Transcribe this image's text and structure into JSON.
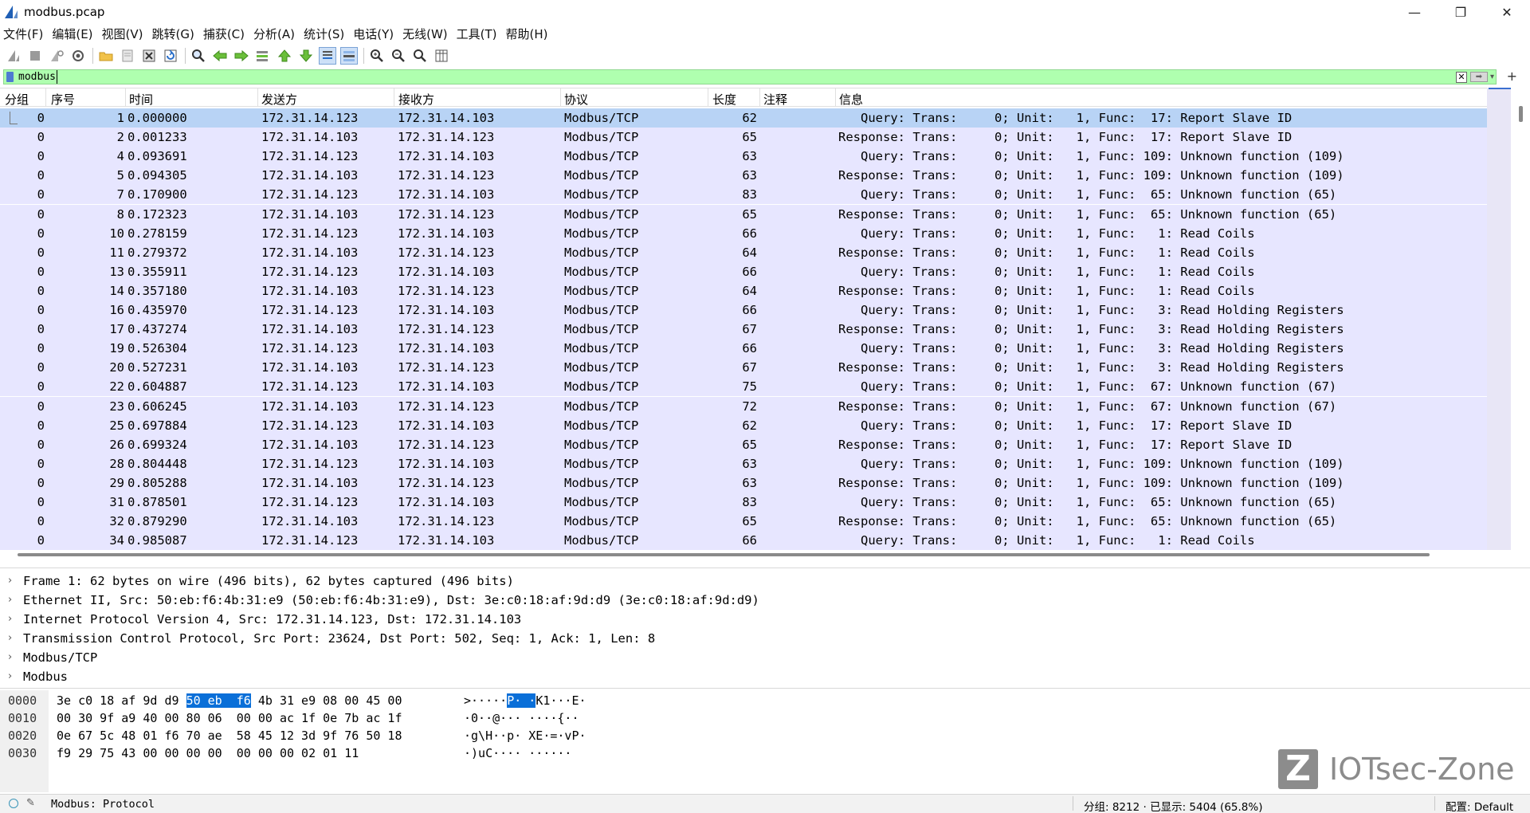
{
  "window": {
    "title": "modbus.pcap",
    "minimize_glyph": "—",
    "maximize_glyph": "❐",
    "close_glyph": "✕"
  },
  "menu": [
    "文件(F)",
    "编辑(E)",
    "视图(V)",
    "跳转(G)",
    "捕获(C)",
    "分析(A)",
    "统计(S)",
    "电话(Y)",
    "无线(W)",
    "工具(T)",
    "帮助(H)"
  ],
  "toolbar_icons": [
    "shark-fin-start-icon",
    "stop-square-icon",
    "restart-fin-icon",
    "capture-options-gear-icon",
    "open-folder-icon",
    "save-file-icon",
    "close-file-icon",
    "reload-icon",
    "find-magnifier-icon",
    "go-back-arrow-icon",
    "go-forward-arrow-icon",
    "go-to-packet-icon",
    "first-packet-icon",
    "last-packet-icon",
    "autoscroll-icon",
    "colorize-icon",
    "zoom-in-icon",
    "zoom-out-icon",
    "normal-size-icon",
    "resize-columns-icon"
  ],
  "filter": {
    "value": "modbus",
    "clear_glyph": "✕",
    "apply_glyph": "➡",
    "dropdown_glyph": "▾",
    "add_glyph": "+"
  },
  "columns": {
    "group": "分组",
    "no": "序号",
    "time": "时间",
    "source": "发送方",
    "destination": "接收方",
    "protocol": "协议",
    "length": "长度",
    "comment": "注释",
    "info": "信息"
  },
  "packets": [
    {
      "group": "0",
      "no": "1",
      "time": "0.000000",
      "src": "172.31.14.123",
      "dst": "172.31.14.103",
      "proto": "Modbus/TCP",
      "len": "62",
      "info": "   Query: Trans:     0; Unit:   1, Func:  17: Report Slave ID"
    },
    {
      "group": "0",
      "no": "2",
      "time": "0.001233",
      "src": "172.31.14.103",
      "dst": "172.31.14.123",
      "proto": "Modbus/TCP",
      "len": "65",
      "info": "Response: Trans:     0; Unit:   1, Func:  17: Report Slave ID"
    },
    {
      "group": "0",
      "no": "4",
      "time": "0.093691",
      "src": "172.31.14.123",
      "dst": "172.31.14.103",
      "proto": "Modbus/TCP",
      "len": "63",
      "info": "   Query: Trans:     0; Unit:   1, Func: 109: Unknown function (109)"
    },
    {
      "group": "0",
      "no": "5",
      "time": "0.094305",
      "src": "172.31.14.103",
      "dst": "172.31.14.123",
      "proto": "Modbus/TCP",
      "len": "63",
      "info": "Response: Trans:     0; Unit:   1, Func: 109: Unknown function (109)"
    },
    {
      "group": "0",
      "no": "7",
      "time": "0.170900",
      "src": "172.31.14.123",
      "dst": "172.31.14.103",
      "proto": "Modbus/TCP",
      "len": "83",
      "info": "   Query: Trans:     0; Unit:   1, Func:  65: Unknown function (65)"
    },
    {
      "group": "0",
      "no": "8",
      "time": "0.172323",
      "src": "172.31.14.103",
      "dst": "172.31.14.123",
      "proto": "Modbus/TCP",
      "len": "65",
      "info": "Response: Trans:     0; Unit:   1, Func:  65: Unknown function (65)"
    },
    {
      "group": "0",
      "no": "10",
      "time": "0.278159",
      "src": "172.31.14.123",
      "dst": "172.31.14.103",
      "proto": "Modbus/TCP",
      "len": "66",
      "info": "   Query: Trans:     0; Unit:   1, Func:   1: Read Coils"
    },
    {
      "group": "0",
      "no": "11",
      "time": "0.279372",
      "src": "172.31.14.103",
      "dst": "172.31.14.123",
      "proto": "Modbus/TCP",
      "len": "64",
      "info": "Response: Trans:     0; Unit:   1, Func:   1: Read Coils"
    },
    {
      "group": "0",
      "no": "13",
      "time": "0.355911",
      "src": "172.31.14.123",
      "dst": "172.31.14.103",
      "proto": "Modbus/TCP",
      "len": "66",
      "info": "   Query: Trans:     0; Unit:   1, Func:   1: Read Coils"
    },
    {
      "group": "0",
      "no": "14",
      "time": "0.357180",
      "src": "172.31.14.103",
      "dst": "172.31.14.123",
      "proto": "Modbus/TCP",
      "len": "64",
      "info": "Response: Trans:     0; Unit:   1, Func:   1: Read Coils"
    },
    {
      "group": "0",
      "no": "16",
      "time": "0.435970",
      "src": "172.31.14.123",
      "dst": "172.31.14.103",
      "proto": "Modbus/TCP",
      "len": "66",
      "info": "   Query: Trans:     0; Unit:   1, Func:   3: Read Holding Registers"
    },
    {
      "group": "0",
      "no": "17",
      "time": "0.437274",
      "src": "172.31.14.103",
      "dst": "172.31.14.123",
      "proto": "Modbus/TCP",
      "len": "67",
      "info": "Response: Trans:     0; Unit:   1, Func:   3: Read Holding Registers"
    },
    {
      "group": "0",
      "no": "19",
      "time": "0.526304",
      "src": "172.31.14.123",
      "dst": "172.31.14.103",
      "proto": "Modbus/TCP",
      "len": "66",
      "info": "   Query: Trans:     0; Unit:   1, Func:   3: Read Holding Registers"
    },
    {
      "group": "0",
      "no": "20",
      "time": "0.527231",
      "src": "172.31.14.103",
      "dst": "172.31.14.123",
      "proto": "Modbus/TCP",
      "len": "67",
      "info": "Response: Trans:     0; Unit:   1, Func:   3: Read Holding Registers"
    },
    {
      "group": "0",
      "no": "22",
      "time": "0.604887",
      "src": "172.31.14.123",
      "dst": "172.31.14.103",
      "proto": "Modbus/TCP",
      "len": "75",
      "info": "   Query: Trans:     0; Unit:   1, Func:  67: Unknown function (67)"
    },
    {
      "group": "0",
      "no": "23",
      "time": "0.606245",
      "src": "172.31.14.103",
      "dst": "172.31.14.123",
      "proto": "Modbus/TCP",
      "len": "72",
      "info": "Response: Trans:     0; Unit:   1, Func:  67: Unknown function (67)"
    },
    {
      "group": "0",
      "no": "25",
      "time": "0.697884",
      "src": "172.31.14.123",
      "dst": "172.31.14.103",
      "proto": "Modbus/TCP",
      "len": "62",
      "info": "   Query: Trans:     0; Unit:   1, Func:  17: Report Slave ID"
    },
    {
      "group": "0",
      "no": "26",
      "time": "0.699324",
      "src": "172.31.14.103",
      "dst": "172.31.14.123",
      "proto": "Modbus/TCP",
      "len": "65",
      "info": "Response: Trans:     0; Unit:   1, Func:  17: Report Slave ID"
    },
    {
      "group": "0",
      "no": "28",
      "time": "0.804448",
      "src": "172.31.14.123",
      "dst": "172.31.14.103",
      "proto": "Modbus/TCP",
      "len": "63",
      "info": "   Query: Trans:     0; Unit:   1, Func: 109: Unknown function (109)"
    },
    {
      "group": "0",
      "no": "29",
      "time": "0.805288",
      "src": "172.31.14.103",
      "dst": "172.31.14.123",
      "proto": "Modbus/TCP",
      "len": "63",
      "info": "Response: Trans:     0; Unit:   1, Func: 109: Unknown function (109)"
    },
    {
      "group": "0",
      "no": "31",
      "time": "0.878501",
      "src": "172.31.14.123",
      "dst": "172.31.14.103",
      "proto": "Modbus/TCP",
      "len": "83",
      "info": "   Query: Trans:     0; Unit:   1, Func:  65: Unknown function (65)"
    },
    {
      "group": "0",
      "no": "32",
      "time": "0.879290",
      "src": "172.31.14.103",
      "dst": "172.31.14.123",
      "proto": "Modbus/TCP",
      "len": "65",
      "info": "Response: Trans:     0; Unit:   1, Func:  65: Unknown function (65)"
    },
    {
      "group": "0",
      "no": "34",
      "time": "0.985087",
      "src": "172.31.14.123",
      "dst": "172.31.14.103",
      "proto": "Modbus/TCP",
      "len": "66",
      "info": "   Query: Trans:     0; Unit:   1, Func:   1: Read Coils"
    }
  ],
  "selected_packet_index": 0,
  "details": [
    "Frame 1: 62 bytes on wire (496 bits), 62 bytes captured (496 bits)",
    "Ethernet II, Src: 50:eb:f6:4b:31:e9 (50:eb:f6:4b:31:e9), Dst: 3e:c0:18:af:9d:d9 (3e:c0:18:af:9d:d9)",
    "Internet Protocol Version 4, Src: 172.31.14.123, Dst: 172.31.14.103",
    "Transmission Control Protocol, Src Port: 23624, Dst Port: 502, Seq: 1, Ack: 1, Len: 8",
    "Modbus/TCP",
    "Modbus"
  ],
  "details_chevron": "›",
  "bytes": [
    {
      "offset": "0000",
      "hex_pre": "3e c0 18 af 9d d9 ",
      "hex_hl": "50 eb  f6",
      "hex_post": " 4b 31 e9 08 00 45 00",
      "ascii_pre": ">·····",
      "ascii_hl": "P· ·",
      "ascii_post": "K1···E·"
    },
    {
      "offset": "0010",
      "hex_pre": "00 30 9f a9 40 00 80 06  00 00 ac 1f 0e 7b ac 1f",
      "hex_hl": "",
      "hex_post": "",
      "ascii_pre": "·0··@··· ····{··",
      "ascii_hl": "",
      "ascii_post": ""
    },
    {
      "offset": "0020",
      "hex_pre": "0e 67 5c 48 01 f6 70 ae  58 45 12 3d 9f 76 50 18",
      "hex_hl": "",
      "hex_post": "",
      "ascii_pre": "·g\\H··p· XE·=·vP·",
      "ascii_hl": "",
      "ascii_post": ""
    },
    {
      "offset": "0030",
      "hex_pre": "f9 29 75 43 00 00 00 00  00 00 00 02 01 11",
      "hex_hl": "",
      "hex_post": "",
      "ascii_pre": "·)uC···· ······",
      "ascii_hl": "",
      "ascii_post": ""
    }
  ],
  "watermark": {
    "logo_letter": "Z",
    "text": "IOTsec-Zone"
  },
  "status": {
    "message": "Modbus: Protocol",
    "counts": "分组: 8212 · 已显示: 5404 (65.8%)",
    "profile": "配置: Default"
  },
  "colors": {
    "row_bg": "#e7e6ff",
    "selected_bg": "#b8d3f5",
    "filter_ok": "#afffaf",
    "bytes_highlight": "#0a6fd8"
  }
}
